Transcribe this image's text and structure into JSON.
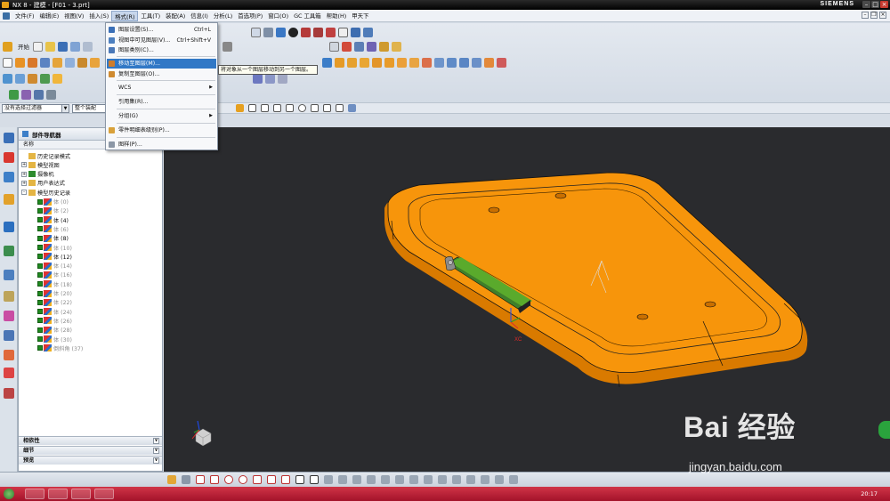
{
  "window": {
    "title": "NX 8 - 建模 - [F01 - 3.prt]",
    "brand": "SIEMENS"
  },
  "menubar": {
    "items": [
      "文件(F)",
      "编辑(E)",
      "视图(V)",
      "插入(S)",
      "格式(R)",
      "工具(T)",
      "装配(A)",
      "信息(I)",
      "分析(L)",
      "首选项(P)",
      "窗口(O)",
      "GC 工具箱",
      "帮助(H)",
      "甲天下"
    ],
    "active_index": 4
  },
  "toolbar": {
    "start_label": "开始"
  },
  "filterbar": {
    "selection_filter": "没有选择过滤器",
    "assembly_scope": "整个装配"
  },
  "format_menu": {
    "items": [
      {
        "label": "图层设置(S)...",
        "shortcut": "Ctrl+L"
      },
      {
        "label": "视图中可见图层(V)...",
        "shortcut": "Ctrl+Shift+V"
      },
      {
        "label": "图层类别(C)...",
        "shortcut": ""
      },
      {
        "label": "移动至图层(M)...",
        "shortcut": ""
      },
      {
        "label": "复制至图层(O)...",
        "shortcut": ""
      },
      {
        "label": "WCS",
        "shortcut": ""
      },
      {
        "label": "引用集(R)...",
        "shortcut": ""
      },
      {
        "label": "分组(G)",
        "shortcut": ""
      },
      {
        "label": "零件明细表级别(P)...",
        "shortcut": ""
      },
      {
        "label": "图样(P)...",
        "shortcut": ""
      }
    ],
    "highlighted_index": 3,
    "tooltip": "将对象从一个图层移动到另一个图层。"
  },
  "navigator": {
    "title": "部件导航器",
    "column_header": "名称",
    "tree": [
      {
        "label": "历史记录模式",
        "level": 0,
        "expander": "",
        "grey": false
      },
      {
        "label": "模型视图",
        "level": 0,
        "expander": "+",
        "grey": false
      },
      {
        "label": "摄像机",
        "level": 0,
        "expander": "+",
        "grey": false
      },
      {
        "label": "用户表达式",
        "level": 0,
        "expander": "+",
        "grey": false
      },
      {
        "label": "模型历史记录",
        "level": 0,
        "expander": "-",
        "grey": false
      },
      {
        "label": "体 (0)",
        "level": 1,
        "grey": true
      },
      {
        "label": "体 (2)",
        "level": 1,
        "grey": true
      },
      {
        "label": "体 (4)",
        "level": 1,
        "grey": false
      },
      {
        "label": "体 (6)",
        "level": 1,
        "grey": true
      },
      {
        "label": "体 (8)",
        "level": 1,
        "grey": false
      },
      {
        "label": "体 (10)",
        "level": 1,
        "grey": true
      },
      {
        "label": "体 (12)",
        "level": 1,
        "grey": false
      },
      {
        "label": "体 (14)",
        "level": 1,
        "grey": true
      },
      {
        "label": "体 (16)",
        "level": 1,
        "grey": true
      },
      {
        "label": "体 (18)",
        "level": 1,
        "grey": true
      },
      {
        "label": "体 (20)",
        "level": 1,
        "grey": true
      },
      {
        "label": "体 (22)",
        "level": 1,
        "grey": true
      },
      {
        "label": "体 (24)",
        "level": 1,
        "grey": true
      },
      {
        "label": "体 (26)",
        "level": 1,
        "grey": true
      },
      {
        "label": "体 (28)",
        "level": 1,
        "grey": true
      },
      {
        "label": "体 (30)",
        "level": 1,
        "grey": true
      },
      {
        "label": "倒斜角 (37)",
        "level": 1,
        "grey": true
      }
    ],
    "panels": [
      "相依性",
      "细节",
      "预览"
    ]
  },
  "viewport": {
    "csys_label": "XC"
  },
  "watermark": {
    "text": "Bai 经验",
    "url": "jingyan.baidu.com"
  },
  "taskbar": {
    "clock": "20:17"
  },
  "colors": {
    "model_orange": "#f7950b",
    "viewport_bg": "#2a2b2e",
    "menu_highlight": "#3178c6",
    "taskbar": "#c1253b"
  }
}
